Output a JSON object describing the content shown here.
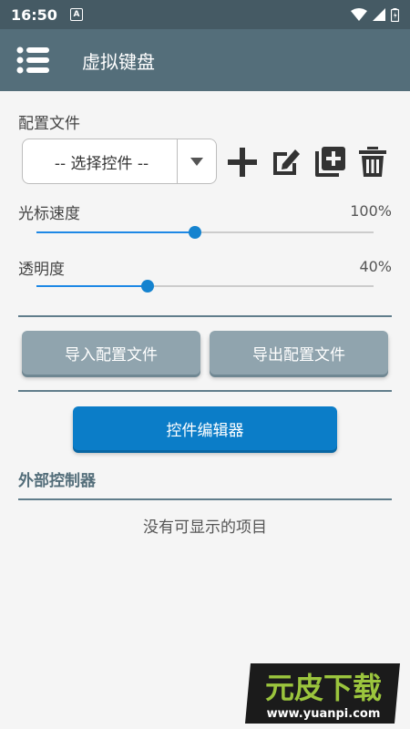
{
  "status_bar": {
    "time": "16:50",
    "notification_letter": "A",
    "icons": [
      "wifi-icon",
      "signal-icon",
      "battery-icon"
    ]
  },
  "app_bar": {
    "title": "虚拟键盘",
    "menu_icon": "hamburger-menu-icon"
  },
  "config": {
    "label": "配置文件",
    "selected": "-- 选择控件 --",
    "actions": [
      "add-icon",
      "edit-icon",
      "copy-icon",
      "delete-icon"
    ]
  },
  "cursor_speed": {
    "label": "光标速度",
    "value_text": "100%",
    "level": 0.47
  },
  "opacity": {
    "label": "透明度",
    "value_text": "40%",
    "level": 0.33
  },
  "buttons": {
    "import": "导入配置文件",
    "export": "导出配置文件",
    "editor": "控件编辑器"
  },
  "external": {
    "title": "外部控制器",
    "empty": "没有可显示的项目"
  },
  "watermark": {
    "brand": "元皮下载",
    "url": "www.yuanpi.com"
  },
  "colors": {
    "status_bar": "#455a64",
    "app_bar": "#546e7a",
    "accent": "#0b7dc8",
    "gray_button": "#90a4ae"
  }
}
